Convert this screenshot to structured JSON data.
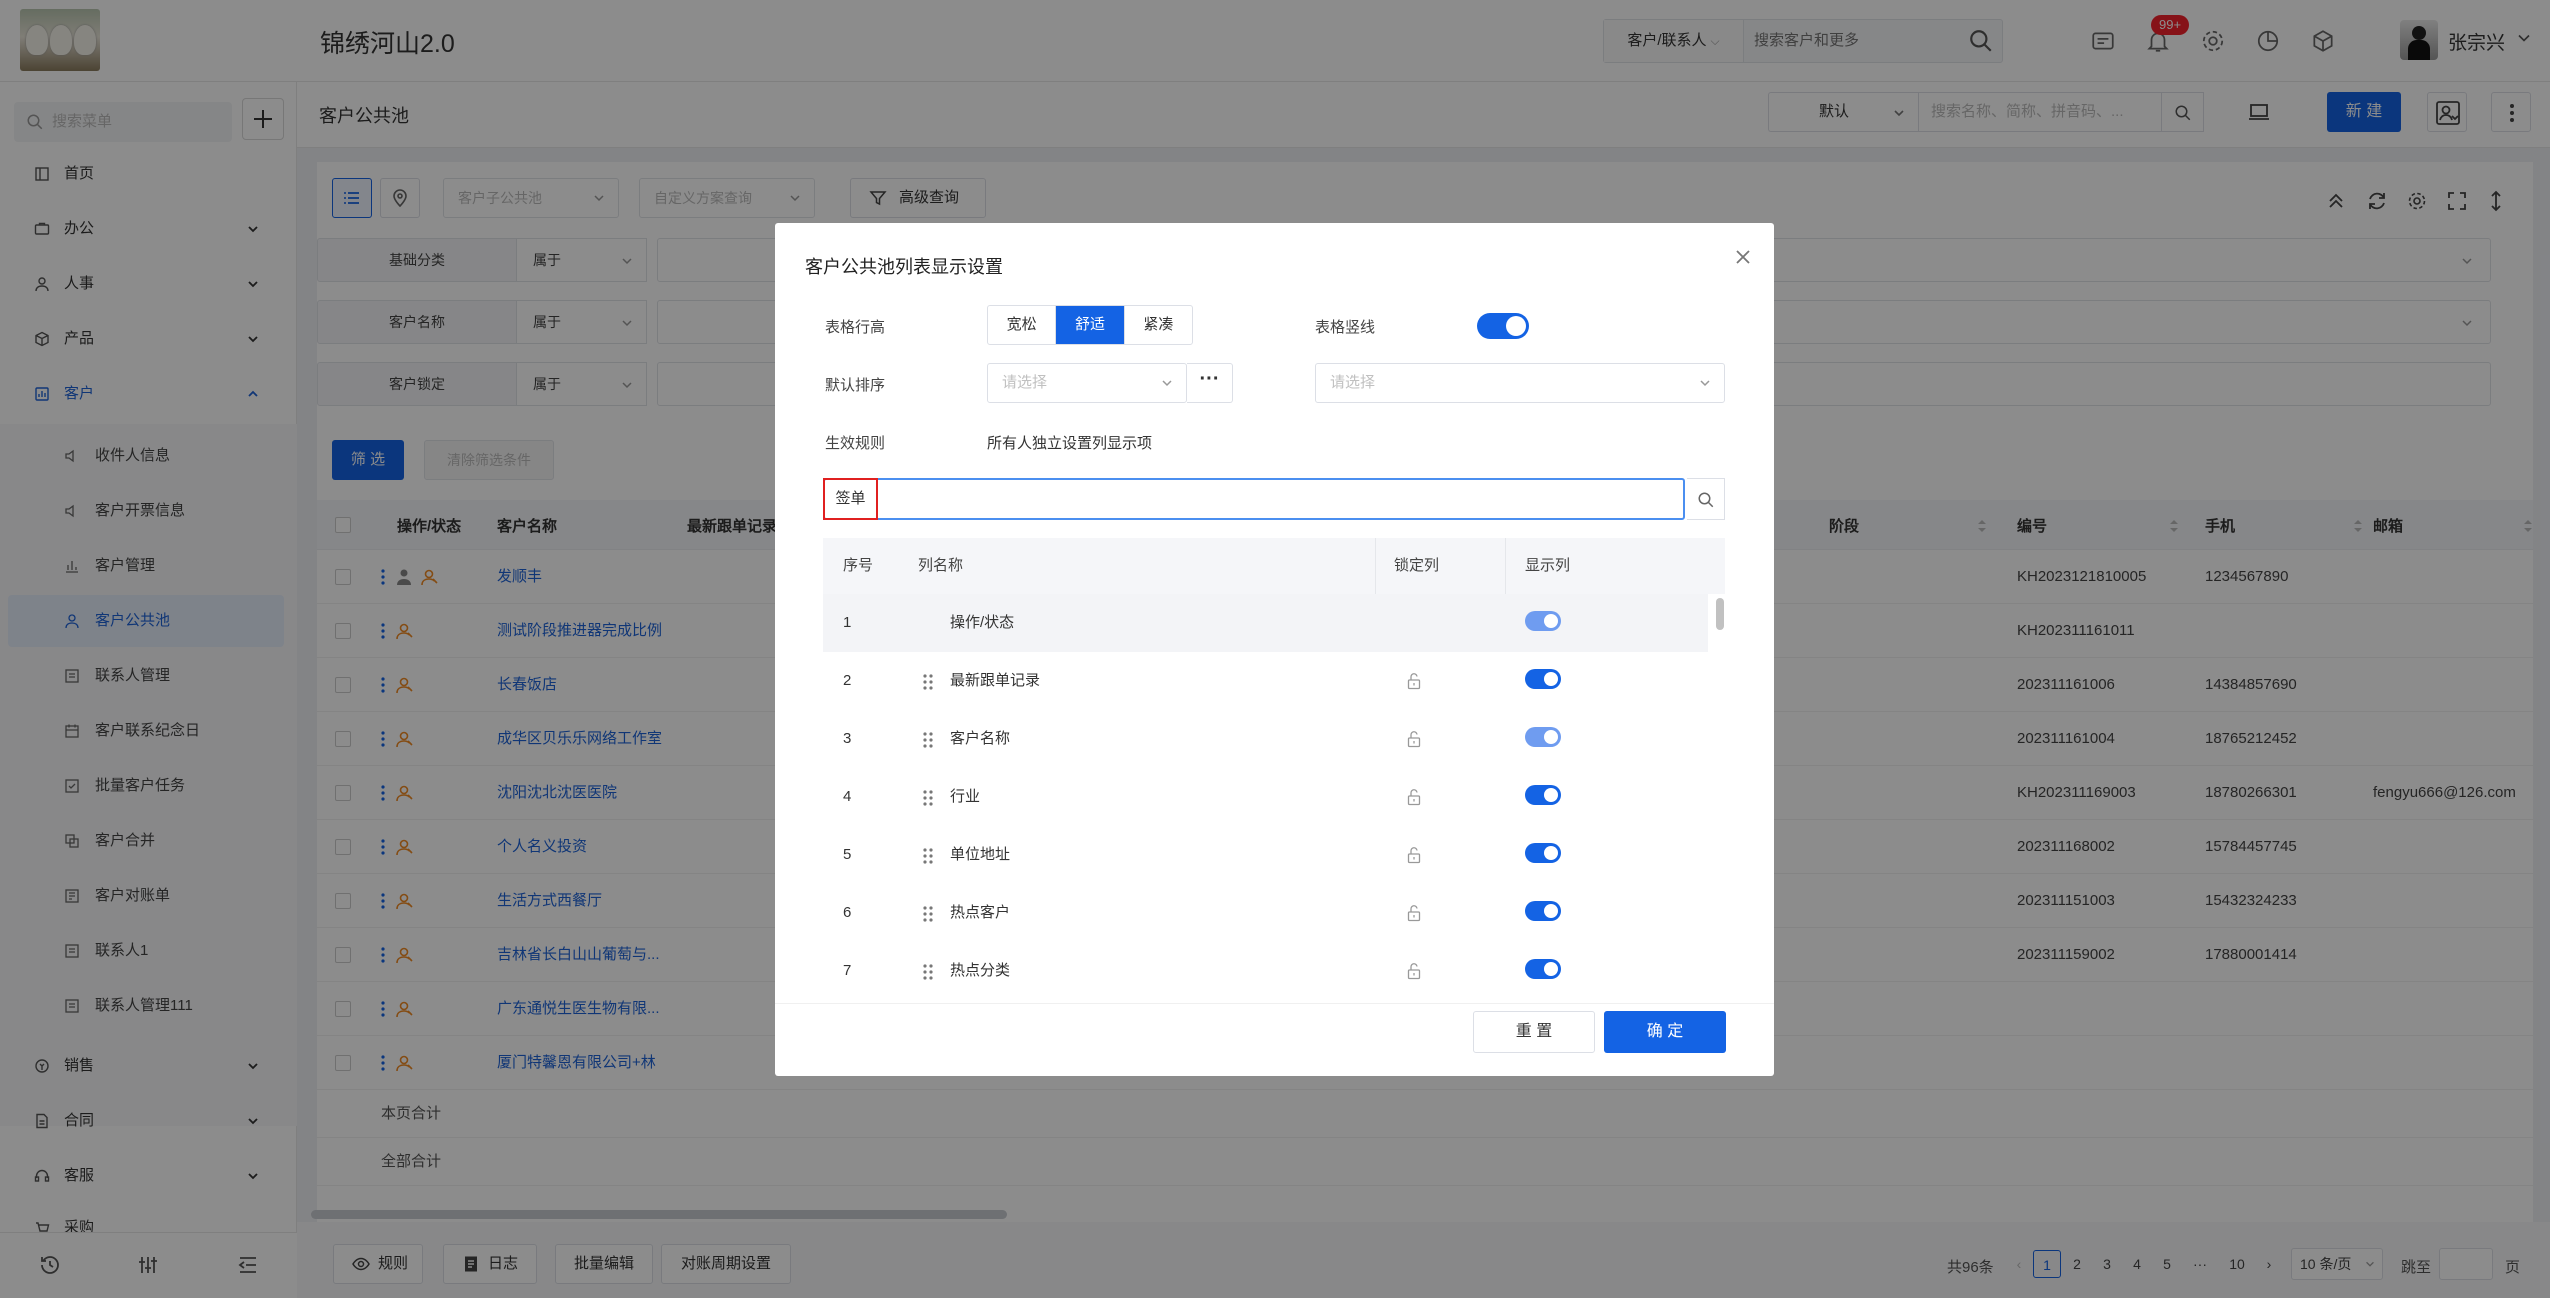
{
  "app": {
    "title": "锦绣河山2.0"
  },
  "top": {
    "search_scope": "客户/联系人",
    "search_placeholder": "搜索客户和更多",
    "notification_count": "99+",
    "user_name": "张宗兴"
  },
  "sidebar": {
    "search_placeholder": "搜索菜单",
    "items": [
      {
        "label": "首页",
        "icon": "home-icon"
      },
      {
        "label": "办公",
        "icon": "briefcase-icon"
      },
      {
        "label": "人事",
        "icon": "people-icon"
      },
      {
        "label": "产品",
        "icon": "box-icon"
      },
      {
        "label": "客户",
        "icon": "customer-icon"
      },
      {
        "label": "销售",
        "icon": "sales-icon"
      },
      {
        "label": "合同",
        "icon": "contract-icon"
      },
      {
        "label": "客服",
        "icon": "service-icon"
      },
      {
        "label": "采购",
        "icon": "purchase-icon"
      }
    ],
    "sub_items": [
      {
        "label": "收件人信息"
      },
      {
        "label": "客户开票信息"
      },
      {
        "label": "客户管理"
      },
      {
        "label": "客户公共池"
      },
      {
        "label": "联系人管理"
      },
      {
        "label": "客户联系纪念日"
      },
      {
        "label": "批量客户任务"
      },
      {
        "label": "客户合并"
      },
      {
        "label": "客户对账单"
      },
      {
        "label": "联系人1"
      },
      {
        "label": "联系人管理111"
      }
    ],
    "active_sub": "客户公共池"
  },
  "page": {
    "title": "客户公共池",
    "view_select": "默认",
    "search_placeholder": "搜索名称、简称、拼音码、...",
    "new_label": "新 建"
  },
  "toolbar": {
    "sub_pool_placeholder": "客户子公共池",
    "scheme_placeholder": "自定义方案查询",
    "advanced_label": "高级查询"
  },
  "filters": [
    {
      "label": "基础分类",
      "op": "属于"
    },
    {
      "label": "客户名称",
      "op": "属于"
    },
    {
      "label": "客户锁定",
      "op": "属于"
    }
  ],
  "filter_buttons": {
    "apply": "筛 选",
    "clear": "清除筛选条件"
  },
  "table": {
    "headers": {
      "ops": "操作/状态",
      "name": "客户名称",
      "latest": "最新跟单记录",
      "stage": "阶段",
      "code": "编号",
      "phone": "手机",
      "mail": "邮箱"
    },
    "rows": [
      {
        "name": "发顺丰",
        "code": "KH2023121810005",
        "phone": "1234567890",
        "mail": ""
      },
      {
        "name": "测试阶段推进器完成比例",
        "code": "KH202311161011",
        "phone": "",
        "mail": ""
      },
      {
        "name": "长春饭店",
        "code": "202311161006",
        "phone": "14384857690",
        "mail": ""
      },
      {
        "name": "成华区贝乐乐网络工作室",
        "code": "202311161004",
        "phone": "18765212452",
        "mail": ""
      },
      {
        "name": "沈阳沈北沈医医院",
        "code": "KH202311169003",
        "phone": "18780266301",
        "mail": "fengyu666@126.com"
      },
      {
        "name": "个人名义投资",
        "code": "202311168002",
        "phone": "15784457745",
        "mail": ""
      },
      {
        "name": "生活方式西餐厅",
        "code": "202311151003",
        "phone": "15432324233",
        "mail": ""
      },
      {
        "name": "吉林省长白山山葡萄与...",
        "code": "202311159002",
        "phone": "17880001414",
        "mail": ""
      },
      {
        "name": "广东通悦生医生物有限...",
        "code": "",
        "phone": "",
        "mail": ""
      },
      {
        "name": "厦门特馨恩有限公司+林",
        "code": "",
        "phone": "",
        "mail": ""
      }
    ],
    "page_total": "本页合计",
    "all_total": "全部合计"
  },
  "footer": {
    "buttons": [
      "规则",
      "日志",
      "批量编辑",
      "对账周期设置"
    ],
    "total": "共96条",
    "pages": [
      "1",
      "2",
      "3",
      "4",
      "5",
      "···",
      "10"
    ],
    "page_size": "10 条/页",
    "jump_label": "跳至",
    "page_unit": "页"
  },
  "modal": {
    "title": "客户公共池列表显示设置",
    "row_height_label": "表格行高",
    "row_height_options": [
      "宽松",
      "舒适",
      "紧凑"
    ],
    "row_height_selected": "舒适",
    "vertical_line_label": "表格竖线",
    "vertical_line_on": true,
    "default_sort_label": "默认排序",
    "sort_placeholder": "请选择",
    "sort_dir_placeholder": "请选择",
    "rule_label": "生效规则",
    "rule_value": "所有人独立设置列显示项",
    "search_value": "签单",
    "columns_header": {
      "no": "序号",
      "name": "列名称",
      "lock": "锁定列",
      "show": "显示列"
    },
    "columns": [
      {
        "no": "1",
        "name": "操作/状态",
        "show": true
      },
      {
        "no": "2",
        "name": "最新跟单记录",
        "show": true
      },
      {
        "no": "3",
        "name": "客户名称",
        "show": true
      },
      {
        "no": "4",
        "name": "行业",
        "show": true
      },
      {
        "no": "5",
        "name": "单位地址",
        "show": true
      },
      {
        "no": "6",
        "name": "热点客户",
        "show": true
      },
      {
        "no": "7",
        "name": "热点分类",
        "show": true
      }
    ],
    "reset_label": "重 置",
    "ok_label": "确 定"
  },
  "colors": {
    "primary": "#1463e4",
    "link": "#1e63d8",
    "badge": "#f5222d"
  }
}
